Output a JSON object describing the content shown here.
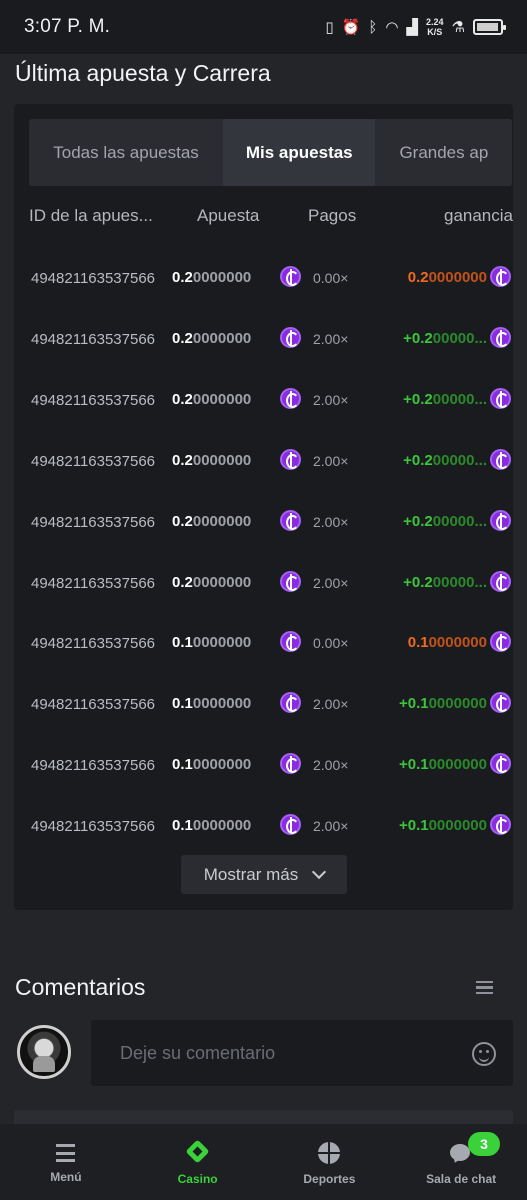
{
  "status_bar": {
    "time": "3:07 P. M.",
    "speed_value": "2.24",
    "speed_unit": "K/S",
    "icons": [
      "vibrate-icon",
      "alarm-icon",
      "bluetooth-icon",
      "wifi-icon",
      "signal-icon",
      "flask-icon",
      "battery-icon"
    ]
  },
  "bets_section": {
    "title": "Última apuesta y Carrera",
    "tabs": [
      {
        "label": "Todas las apuestas",
        "active": false
      },
      {
        "label": "Mis apuestas",
        "active": true
      },
      {
        "label": "Grandes ap",
        "active": false
      }
    ],
    "columns": {
      "id": "ID de la apues...",
      "bet": "Apuesta",
      "payout": "Pagos",
      "profit": "ganancia"
    },
    "rows": [
      {
        "id": "494821163537566",
        "bet_bold": "0.2",
        "bet_rest": "0000000",
        "payout": "0.00×",
        "win_bold": "0.2",
        "win_rest": "0000000",
        "result": "loss"
      },
      {
        "id": "494821163537566",
        "bet_bold": "0.2",
        "bet_rest": "0000000",
        "payout": "2.00×",
        "win_bold": "+0.2",
        "win_rest": "00000...",
        "result": "win"
      },
      {
        "id": "494821163537566",
        "bet_bold": "0.2",
        "bet_rest": "0000000",
        "payout": "2.00×",
        "win_bold": "+0.2",
        "win_rest": "00000...",
        "result": "win"
      },
      {
        "id": "494821163537566",
        "bet_bold": "0.2",
        "bet_rest": "0000000",
        "payout": "2.00×",
        "win_bold": "+0.2",
        "win_rest": "00000...",
        "result": "win"
      },
      {
        "id": "494821163537566",
        "bet_bold": "0.2",
        "bet_rest": "0000000",
        "payout": "2.00×",
        "win_bold": "+0.2",
        "win_rest": "00000...",
        "result": "win"
      },
      {
        "id": "494821163537566",
        "bet_bold": "0.2",
        "bet_rest": "0000000",
        "payout": "2.00×",
        "win_bold": "+0.2",
        "win_rest": "00000...",
        "result": "win"
      },
      {
        "id": "494821163537566",
        "bet_bold": "0.1",
        "bet_rest": "0000000",
        "payout": "0.00×",
        "win_bold": "0.1",
        "win_rest": "0000000",
        "result": "loss"
      },
      {
        "id": "494821163537566",
        "bet_bold": "0.1",
        "bet_rest": "0000000",
        "payout": "2.00×",
        "win_bold": "+0.1",
        "win_rest": "0000000",
        "result": "win"
      },
      {
        "id": "494821163537566",
        "bet_bold": "0.1",
        "bet_rest": "0000000",
        "payout": "2.00×",
        "win_bold": "+0.1",
        "win_rest": "0000000",
        "result": "win"
      },
      {
        "id": "494821163537566",
        "bet_bold": "0.1",
        "bet_rest": "0000000",
        "payout": "2.00×",
        "win_bold": "+0.1",
        "win_rest": "0000000",
        "result": "win"
      }
    ],
    "show_more_label": "Mostrar más"
  },
  "comments": {
    "title": "Comentarios",
    "placeholder": "Deje su comentario"
  },
  "bottom_nav": {
    "items": [
      {
        "label": "Menú",
        "icon": "menu-icon",
        "active": false
      },
      {
        "label": "Casino",
        "icon": "casino-icon",
        "active": true
      },
      {
        "label": "Deportes",
        "icon": "sports-icon",
        "active": false
      },
      {
        "label": "Sala de chat",
        "icon": "chat-icon",
        "active": false
      }
    ],
    "chat_badge": "3"
  },
  "colors": {
    "accent_green": "#3ad13a",
    "loss_orange": "#f06a1e",
    "coin_purple": "#8a2be2",
    "background": "#232529",
    "panel": "#1a1b1e"
  }
}
